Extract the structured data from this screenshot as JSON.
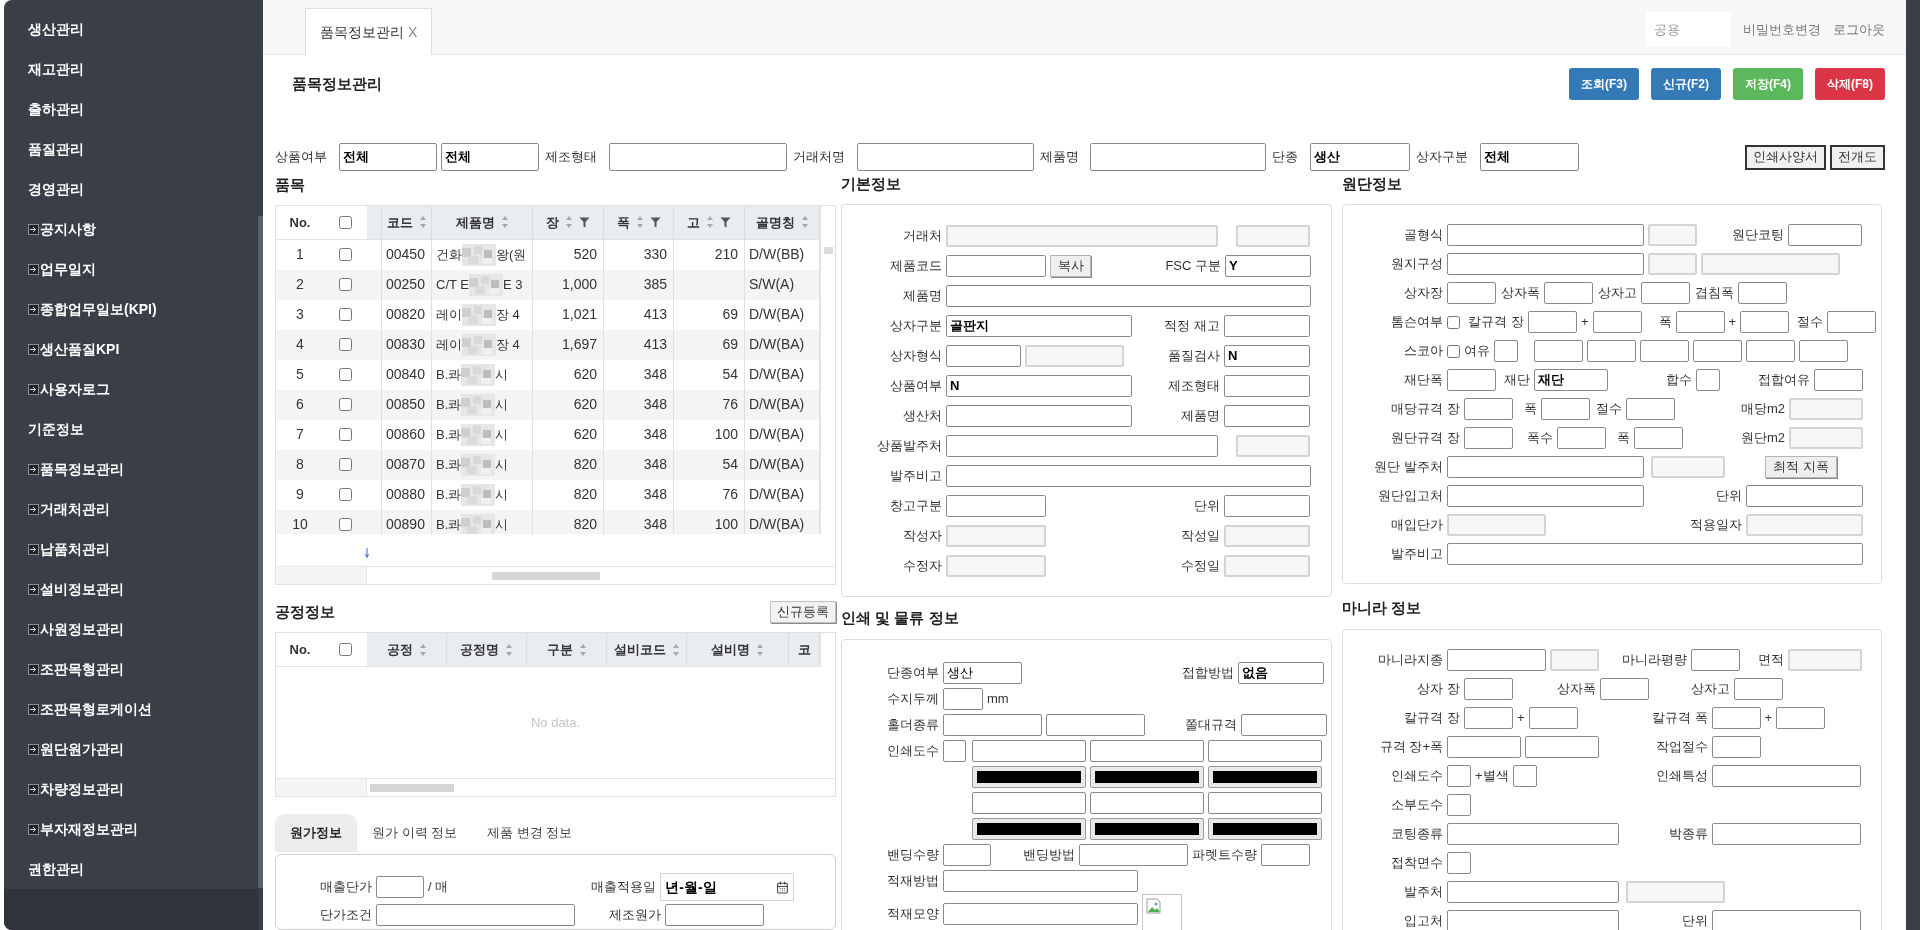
{
  "sidebar": {
    "items": [
      {
        "label": "생산관리",
        "kind": "group"
      },
      {
        "label": "재고관리",
        "kind": "group"
      },
      {
        "label": "출하관리",
        "kind": "group"
      },
      {
        "label": "품질관리",
        "kind": "group"
      },
      {
        "label": "경영관리",
        "kind": "group"
      },
      {
        "label": "공지사항",
        "kind": "page"
      },
      {
        "label": "업무일지",
        "kind": "page"
      },
      {
        "label": "종합업무일보(KPI)",
        "kind": "page"
      },
      {
        "label": "생산품질KPI",
        "kind": "page"
      },
      {
        "label": "사용자로그",
        "kind": "page"
      },
      {
        "label": "기준정보",
        "kind": "group"
      },
      {
        "label": "품목정보관리",
        "kind": "page"
      },
      {
        "label": "거래처관리",
        "kind": "page"
      },
      {
        "label": "납품처관리",
        "kind": "page"
      },
      {
        "label": "설비정보관리",
        "kind": "page"
      },
      {
        "label": "사원정보관리",
        "kind": "page"
      },
      {
        "label": "조판목형관리",
        "kind": "page"
      },
      {
        "label": "조판목형로케이션",
        "kind": "page"
      },
      {
        "label": "원단원가관리",
        "kind": "page"
      },
      {
        "label": "차량정보관리",
        "kind": "page"
      },
      {
        "label": "부자재정보관리",
        "kind": "page"
      },
      {
        "label": "권한관리",
        "kind": "group"
      }
    ]
  },
  "top_bar": {
    "tabs": [
      {
        "label": "품목정보관리",
        "close": "X",
        "selected": true
      }
    ],
    "user": "공용",
    "links": [
      "비밀번호변경",
      "로그아웃"
    ]
  },
  "page": {
    "title": "품목정보관리",
    "actions": [
      {
        "label": "조회(F3)",
        "color": "#337ab7"
      },
      {
        "label": "신규(F2)",
        "color": "#337ab7"
      },
      {
        "label": "저장(F4)",
        "color": "#5cb85c"
      },
      {
        "label": "삭제(F8)",
        "color": "#dc3545"
      }
    ]
  },
  "filters": [
    {
      "items": [
        {
          "kind": "label",
          "text": "상품여부"
        },
        {
          "kind": "field",
          "value": "전체",
          "disabled": false
        },
        {
          "kind": "field",
          "value": "전체",
          "disabled": false
        },
        {
          "kind": "label",
          "text": "제조형태"
        },
        {
          "kind": "field",
          "disabled": false
        },
        {
          "kind": "label",
          "text": "거래처명"
        },
        {
          "kind": "field",
          "disabled": false
        },
        {
          "kind": "label",
          "text": "제품명"
        },
        {
          "kind": "field",
          "disabled": false
        },
        {
          "kind": "label",
          "text": "단종"
        },
        {
          "kind": "field",
          "value": "생산",
          "disabled": false
        },
        {
          "kind": "label",
          "text": "상자구분"
        },
        {
          "kind": "field",
          "value": "전체",
          "disabled": false
        }
      ]
    }
  ],
  "filter_buttons": [
    "인쇄사양서",
    "전개도"
  ],
  "items_grid": {
    "title": "품목",
    "number_header": "No.",
    "select_all": {
      "checked": false
    },
    "columns": [
      {
        "label": "코드",
        "sortable": true,
        "filterable": false
      },
      {
        "label": "제품명",
        "sortable": true,
        "filterable": false
      },
      {
        "label": "장",
        "sortable": true,
        "filterable": true
      },
      {
        "label": "폭",
        "sortable": true,
        "filterable": true
      },
      {
        "label": "고",
        "sortable": true,
        "filterable": true
      },
      {
        "label": "골명칭",
        "sortable": true,
        "filterable": false
      }
    ],
    "rows": [
      {
        "no": "1",
        "checked": false,
        "cells": [
          "00450",
          {
            "start": "건화",
            "redacted": true,
            "end": "왕(원"
          },
          "520",
          "330",
          "210",
          "D/W(BB)"
        ]
      },
      {
        "no": "2",
        "checked": false,
        "cells": [
          "00250",
          {
            "start": "C/T E",
            "redacted": true,
            "end": "E 3"
          },
          "1,000",
          "385",
          null,
          "S/W(A)"
        ]
      },
      {
        "no": "3",
        "checked": false,
        "cells": [
          "00820",
          {
            "start": "레이",
            "redacted": true,
            "end": "장 4"
          },
          "1,021",
          "413",
          "69",
          "D/W(BA)"
        ]
      },
      {
        "no": "4",
        "checked": false,
        "cells": [
          "00830",
          {
            "start": "레이",
            "redacted": true,
            "end": "장 4"
          },
          "1,697",
          "413",
          "69",
          "D/W(BA)"
        ]
      },
      {
        "no": "5",
        "checked": false,
        "cells": [
          "00840",
          {
            "start": "B.콰",
            "redacted": true,
            "end": "시"
          },
          "620",
          "348",
          "54",
          "D/W(BA)"
        ]
      },
      {
        "no": "6",
        "checked": false,
        "cells": [
          "00850",
          {
            "start": "B.콰",
            "redacted": true,
            "end": "시"
          },
          "620",
          "348",
          "76",
          "D/W(BA)"
        ]
      },
      {
        "no": "7",
        "checked": false,
        "cells": [
          "00860",
          {
            "start": "B.콰",
            "redacted": true,
            "end": "시"
          },
          "620",
          "348",
          "100",
          "D/W(BA)"
        ]
      },
      {
        "no": "8",
        "checked": false,
        "cells": [
          "00870",
          {
            "start": "B.콰",
            "redacted": true,
            "end": "시"
          },
          "820",
          "348",
          "54",
          "D/W(BA)"
        ]
      },
      {
        "no": "9",
        "checked": false,
        "cells": [
          "00880",
          {
            "start": "B.콰",
            "redacted": true,
            "end": "시"
          },
          "820",
          "348",
          "76",
          "D/W(BA)"
        ]
      },
      {
        "no": "10",
        "checked": false,
        "cells": [
          "00890",
          {
            "start": "B.콰",
            "redacted": true,
            "end": "시"
          },
          "820",
          "348",
          "100",
          "D/W(BA)"
        ]
      }
    ]
  },
  "process_grid": {
    "title": "공정정보",
    "action": "신규등록",
    "number_header": "No.",
    "select_all": {
      "checked": false
    },
    "columns": [
      {
        "label": "공정",
        "sortable": true
      },
      {
        "label": "공정명",
        "sortable": true
      },
      {
        "label": "구분",
        "sortable": true
      },
      {
        "label": "설비코드",
        "sortable": true
      },
      {
        "label": "설비명",
        "sortable": true
      },
      {
        "label": "코",
        "sortable": false
      }
    ],
    "empty_text": "No data."
  },
  "cost_tabs": [
    {
      "label": "원가정보",
      "selected": true
    },
    {
      "label": "원가 이력 정보",
      "selected": false
    },
    {
      "label": "제품 변경 정보",
      "selected": false
    }
  ],
  "cost_info": {
    "rows": [
      {
        "items": [
          {
            "kind": "label",
            "text": "매출단가"
          },
          {
            "kind": "field",
            "disabled": false
          },
          {
            "kind": "unit",
            "text": "/ 매"
          },
          {
            "kind": "label",
            "text": "매출적용일"
          },
          {
            "kind": "date",
            "value": "년-월-일"
          }
        ]
      },
      {
        "items": [
          {
            "kind": "label",
            "text": "단가조건"
          },
          {
            "kind": "field",
            "disabled": false
          },
          {
            "kind": "label",
            "text": "제조원가"
          },
          {
            "kind": "field",
            "disabled": false
          }
        ]
      }
    ]
  },
  "basic_info": {
    "title": "기본정보",
    "rows": [
      {
        "items": [
          {
            "kind": "label",
            "text": "거래처"
          },
          {
            "kind": "field",
            "disabled": true
          },
          {
            "kind": "field",
            "disabled": true
          }
        ]
      },
      {
        "items": [
          {
            "kind": "label",
            "text": "제품코드"
          },
          {
            "kind": "field",
            "disabled": false
          },
          {
            "kind": "button",
            "text": "복사"
          },
          {
            "kind": "label",
            "text": "FSC 구분"
          },
          {
            "kind": "field",
            "value": "Y",
            "disabled": false
          }
        ]
      },
      {
        "items": [
          {
            "kind": "label",
            "text": "제품명"
          },
          {
            "kind": "field",
            "disabled": false
          }
        ]
      },
      {
        "items": [
          {
            "kind": "label",
            "text": "상자구분"
          },
          {
            "kind": "field",
            "value": "골판지",
            "disabled": false
          },
          {
            "kind": "label",
            "text": "적정 재고"
          },
          {
            "kind": "field",
            "disabled": false
          }
        ]
      },
      {
        "items": [
          {
            "kind": "label",
            "text": "상자형식"
          },
          {
            "kind": "field",
            "disabled": false
          },
          {
            "kind": "field",
            "disabled": true
          },
          {
            "kind": "label",
            "text": "품질검사"
          },
          {
            "kind": "field",
            "value": "N",
            "disabled": false
          }
        ]
      },
      {
        "items": [
          {
            "kind": "label",
            "text": "상품여부"
          },
          {
            "kind": "field",
            "value": "N",
            "disabled": false
          },
          {
            "kind": "label",
            "text": "제조형태"
          },
          {
            "kind": "field",
            "disabled": false
          }
        ]
      },
      {
        "items": [
          {
            "kind": "label",
            "text": "생산처"
          },
          {
            "kind": "field",
            "disabled": false
          },
          {
            "kind": "label",
            "text": "제품명"
          },
          {
            "kind": "field",
            "disabled": false
          }
        ]
      },
      {
        "items": [
          {
            "kind": "label",
            "text": "상품발주처"
          },
          {
            "kind": "field",
            "disabled": false
          },
          {
            "kind": "field",
            "disabled": true
          }
        ]
      },
      {
        "items": [
          {
            "kind": "label",
            "text": "발주비고"
          },
          {
            "kind": "field",
            "disabled": false
          }
        ]
      },
      {
        "items": [
          {
            "kind": "label",
            "text": "창고구분"
          },
          {
            "kind": "field",
            "disabled": false
          },
          {
            "kind": "label",
            "text": "단위"
          },
          {
            "kind": "field",
            "disabled": false
          }
        ]
      },
      {
        "items": [
          {
            "kind": "label",
            "text": "작성자"
          },
          {
            "kind": "field",
            "disabled": true
          },
          {
            "kind": "label",
            "text": "작성일"
          },
          {
            "kind": "field",
            "disabled": true
          }
        ]
      },
      {
        "items": [
          {
            "kind": "label",
            "text": "수정자"
          },
          {
            "kind": "field",
            "disabled": true
          },
          {
            "kind": "label",
            "text": "수정일"
          },
          {
            "kind": "field",
            "disabled": true
          }
        ]
      }
    ]
  },
  "print_info": {
    "title": "인쇄 및 물류 정보",
    "rows": [
      {
        "items": [
          {
            "kind": "label",
            "text": "단종여부"
          },
          {
            "kind": "plain_field",
            "value": "생산",
            "disabled": false
          },
          {
            "kind": "label",
            "text": "접합방법"
          },
          {
            "kind": "field",
            "value": "없음",
            "disabled": false
          }
        ]
      },
      {
        "items": [
          {
            "kind": "label",
            "text": "수지두께"
          },
          {
            "kind": "field",
            "disabled": false
          },
          {
            "kind": "unit",
            "text": "mm"
          }
        ]
      },
      {
        "items": [
          {
            "kind": "label",
            "text": "홀더종류"
          },
          {
            "kind": "field",
            "disabled": false
          },
          {
            "kind": "field",
            "disabled": false
          },
          {
            "kind": "label",
            "text": "쫄대규격"
          },
          {
            "kind": "field",
            "disabled": false
          }
        ]
      },
      {
        "items": [
          {
            "kind": "label",
            "text": "인쇄도수"
          },
          {
            "kind": "field",
            "disabled": false
          },
          {
            "kind": "field",
            "disabled": false
          },
          {
            "kind": "field",
            "disabled": false
          },
          {
            "kind": "field",
            "disabled": false
          }
        ]
      },
      {
        "items": [
          {
            "kind": "color",
            "color": "#000000"
          },
          {
            "kind": "color",
            "color": "#000000"
          },
          {
            "kind": "color",
            "color": "#000000"
          }
        ]
      },
      {
        "items": [
          {
            "kind": "field",
            "disabled": false
          },
          {
            "kind": "field",
            "disabled": false
          },
          {
            "kind": "field",
            "disabled": false
          }
        ]
      },
      {
        "items": [
          {
            "kind": "color",
            "color": "#000000"
          },
          {
            "kind": "color",
            "color": "#000000"
          },
          {
            "kind": "color",
            "color": "#000000"
          }
        ]
      },
      {
        "items": [
          {
            "kind": "label",
            "text": "밴딩수량"
          },
          {
            "kind": "field",
            "disabled": false
          },
          {
            "kind": "label",
            "text": "밴딩방법"
          },
          {
            "kind": "field",
            "disabled": false
          },
          {
            "kind": "label",
            "text": "파렛트수량"
          },
          {
            "kind": "field",
            "disabled": false
          }
        ]
      },
      {
        "items": [
          {
            "kind": "label",
            "text": "적재방법"
          },
          {
            "kind": "field",
            "disabled": false
          }
        ]
      },
      {
        "items": [
          {
            "kind": "label",
            "text": "적재모양"
          },
          {
            "kind": "field",
            "disabled": false
          },
          {
            "kind": "image"
          }
        ]
      }
    ]
  },
  "paper_info": {
    "title": "원단정보",
    "rows": [
      {
        "items": [
          {
            "kind": "label",
            "text": "골형식"
          },
          {
            "kind": "field",
            "disabled": false
          },
          {
            "kind": "field",
            "disabled": true
          },
          {
            "kind": "label",
            "text": "원단코팅"
          },
          {
            "kind": "field",
            "disabled": false
          }
        ]
      },
      {
        "items": [
          {
            "kind": "label",
            "text": "원지구성"
          },
          {
            "kind": "field",
            "disabled": false
          },
          {
            "kind": "field",
            "disabled": true
          },
          {
            "kind": "field",
            "disabled": true
          }
        ]
      },
      {
        "items": [
          {
            "kind": "label",
            "text": "상자장"
          },
          {
            "kind": "field",
            "disabled": false
          },
          {
            "kind": "label",
            "text": "상자폭"
          },
          {
            "kind": "field",
            "disabled": false
          },
          {
            "kind": "label",
            "text": "상자고"
          },
          {
            "kind": "field",
            "disabled": false
          },
          {
            "kind": "label",
            "text": "겹침폭"
          },
          {
            "kind": "field",
            "disabled": false
          }
        ]
      },
      {
        "items": [
          {
            "kind": "label",
            "text": "톰슨여부"
          },
          {
            "kind": "check",
            "checked": false
          },
          {
            "kind": "label",
            "text": "칼규격 장"
          },
          {
            "kind": "field",
            "disabled": false
          },
          {
            "kind": "unit",
            "text": "+"
          },
          {
            "kind": "field",
            "disabled": false
          },
          {
            "kind": "label",
            "text": "폭"
          },
          {
            "kind": "field",
            "disabled": false
          },
          {
            "kind": "unit",
            "text": "+"
          },
          {
            "kind": "field",
            "disabled": false
          },
          {
            "kind": "label",
            "text": "절수"
          },
          {
            "kind": "field",
            "disabled": false
          }
        ]
      },
      {
        "items": [
          {
            "kind": "label",
            "text": "스코아"
          },
          {
            "kind": "check",
            "checked": false
          },
          {
            "kind": "label",
            "text": "여유"
          },
          {
            "kind": "field",
            "disabled": false
          },
          {
            "kind": "field",
            "disabled": false
          },
          {
            "kind": "field",
            "disabled": false
          },
          {
            "kind": "field",
            "disabled": false
          },
          {
            "kind": "field",
            "disabled": false
          },
          {
            "kind": "field",
            "disabled": false
          },
          {
            "kind": "field",
            "disabled": false
          }
        ]
      },
      {
        "items": [
          {
            "kind": "label",
            "text": "재단폭"
          },
          {
            "kind": "field",
            "disabled": false
          },
          {
            "kind": "label",
            "text": "재단"
          },
          {
            "kind": "field",
            "value": "재단",
            "disabled": false
          },
          {
            "kind": "label",
            "text": "합수"
          },
          {
            "kind": "field",
            "disabled": false
          },
          {
            "kind": "label",
            "text": "접합여유"
          },
          {
            "kind": "field",
            "disabled": false
          }
        ]
      },
      {
        "items": [
          {
            "kind": "label",
            "text": "매당규격"
          },
          {
            "kind": "unit",
            "text": "장"
          },
          {
            "kind": "field",
            "disabled": false
          },
          {
            "kind": "label",
            "text": "폭"
          },
          {
            "kind": "field",
            "disabled": false
          },
          {
            "kind": "label",
            "text": "절수"
          },
          {
            "kind": "field",
            "disabled": false
          },
          {
            "kind": "label",
            "text": "매당m2"
          },
          {
            "kind": "field",
            "disabled": true
          }
        ]
      },
      {
        "items": [
          {
            "kind": "label",
            "text": "원단규격"
          },
          {
            "kind": "unit",
            "text": "장"
          },
          {
            "kind": "field",
            "disabled": false
          },
          {
            "kind": "label",
            "text": "폭수"
          },
          {
            "kind": "field",
            "disabled": false
          },
          {
            "kind": "label",
            "text": "폭"
          },
          {
            "kind": "field",
            "disabled": false
          },
          {
            "kind": "label",
            "text": "원단m2"
          },
          {
            "kind": "field",
            "disabled": true
          }
        ]
      },
      {
        "items": [
          {
            "kind": "label",
            "text": "원단 발주처"
          },
          {
            "kind": "field",
            "disabled": false
          },
          {
            "kind": "field",
            "disabled": true
          },
          {
            "kind": "button",
            "text": "최적 지폭"
          }
        ]
      },
      {
        "items": [
          {
            "kind": "label",
            "text": "원단입고처"
          },
          {
            "kind": "field",
            "disabled": false
          },
          {
            "kind": "label",
            "text": "단위"
          },
          {
            "kind": "field",
            "disabled": false
          }
        ]
      },
      {
        "items": [
          {
            "kind": "label",
            "text": "매입단가"
          },
          {
            "kind": "field",
            "disabled": true
          },
          {
            "kind": "label",
            "text": "적용일자"
          },
          {
            "kind": "field",
            "disabled": true
          }
        ]
      },
      {
        "items": [
          {
            "kind": "label",
            "text": "발주비고"
          },
          {
            "kind": "field",
            "disabled": false
          }
        ]
      }
    ]
  },
  "manila_info": {
    "title": "마니라 정보",
    "rows": [
      {
        "items": [
          {
            "kind": "label",
            "text": "마니라지종"
          },
          {
            "kind": "field",
            "disabled": false
          },
          {
            "kind": "field",
            "disabled": true
          },
          {
            "kind": "label",
            "text": "마니라평량"
          },
          {
            "kind": "field",
            "disabled": false
          },
          {
            "kind": "label",
            "text": "면적"
          },
          {
            "kind": "field",
            "disabled": true
          }
        ]
      },
      {
        "items": [
          {
            "kind": "label",
            "text": "상자"
          },
          {
            "kind": "unit",
            "text": "장"
          },
          {
            "kind": "field",
            "disabled": false
          },
          {
            "kind": "label",
            "text": "상자폭"
          },
          {
            "kind": "field",
            "disabled": false
          },
          {
            "kind": "label",
            "text": "상자고"
          },
          {
            "kind": "field",
            "disabled": false
          }
        ]
      },
      {
        "items": [
          {
            "kind": "label",
            "text": "칼규격"
          },
          {
            "kind": "unit",
            "text": "장"
          },
          {
            "kind": "field",
            "disabled": false
          },
          {
            "kind": "unit",
            "text": "+"
          },
          {
            "kind": "field",
            "disabled": false
          },
          {
            "kind": "label",
            "text": "칼규격 폭"
          },
          {
            "kind": "field",
            "disabled": false
          },
          {
            "kind": "unit",
            "text": "+"
          },
          {
            "kind": "field",
            "disabled": false
          }
        ]
      },
      {
        "items": [
          {
            "kind": "label",
            "text": "규격 장+폭"
          },
          {
            "kind": "field",
            "disabled": false
          },
          {
            "kind": "field",
            "disabled": false
          },
          {
            "kind": "label",
            "text": "작업절수"
          },
          {
            "kind": "field",
            "disabled": false
          }
        ]
      },
      {
        "items": [
          {
            "kind": "label",
            "text": "인쇄도수"
          },
          {
            "kind": "field",
            "disabled": false
          },
          {
            "kind": "unit",
            "text": "+별색"
          },
          {
            "kind": "field",
            "disabled": false
          },
          {
            "kind": "label",
            "text": "인쇄특성"
          },
          {
            "kind": "field",
            "disabled": false
          }
        ]
      },
      {
        "items": [
          {
            "kind": "label",
            "text": "소부도수"
          },
          {
            "kind": "field",
            "disabled": false
          }
        ]
      },
      {
        "items": [
          {
            "kind": "label",
            "text": "코팅종류"
          },
          {
            "kind": "field",
            "disabled": false
          },
          {
            "kind": "label",
            "text": "박종류"
          },
          {
            "kind": "field",
            "disabled": false
          }
        ]
      },
      {
        "items": [
          {
            "kind": "label",
            "text": "접착면수"
          },
          {
            "kind": "field",
            "disabled": false
          }
        ]
      },
      {
        "items": [
          {
            "kind": "label",
            "text": "발주처"
          },
          {
            "kind": "field",
            "disabled": false
          },
          {
            "kind": "field",
            "disabled": true
          }
        ]
      },
      {
        "items": [
          {
            "kind": "label",
            "text": "입고처"
          },
          {
            "kind": "field",
            "disabled": false
          },
          {
            "kind": "label",
            "text": "단위"
          },
          {
            "kind": "field",
            "disabled": false
          }
        ]
      }
    ]
  }
}
